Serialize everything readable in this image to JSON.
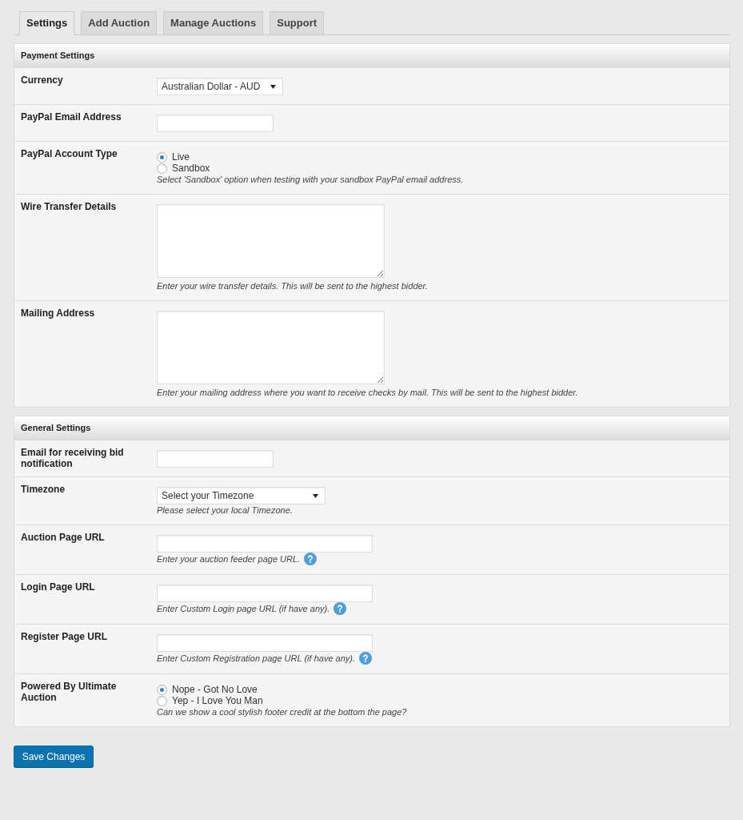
{
  "tabs": [
    {
      "label": "Settings",
      "selected": true
    },
    {
      "label": "Add Auction",
      "selected": false
    },
    {
      "label": "Manage Auctions",
      "selected": false
    },
    {
      "label": "Support",
      "selected": false
    }
  ],
  "sections": [
    {
      "title": "Payment Settings",
      "fields": [
        {
          "kind": "select",
          "label": "Currency",
          "value": "Australian Dollar - AUD"
        },
        {
          "kind": "text",
          "label": "PayPal Email Address"
        },
        {
          "kind": "radio",
          "label": "PayPal Account Type",
          "options": [
            {
              "label": "Live",
              "selected": true
            },
            {
              "label": "Sandbox",
              "selected": false
            }
          ],
          "help": "Select 'Sandbox' option when testing with your sandbox PayPal email address."
        },
        {
          "kind": "textarea",
          "label": "Wire Transfer Details",
          "help": "Enter your wire transfer details. This will be sent to the highest bidder."
        },
        {
          "kind": "textarea",
          "label": "Mailing Address",
          "help": "Enter your mailing address where you want to receive checks by mail. This will be sent to the highest bidder."
        }
      ]
    },
    {
      "title": "General Settings",
      "fields": [
        {
          "kind": "text",
          "label": "Email for receiving bid notification"
        },
        {
          "kind": "select",
          "label": "Timezone",
          "value": "Select your Timezone",
          "help": "Please select your local Timezone."
        },
        {
          "kind": "url",
          "label": "Auction Page URL",
          "help": "Enter your auction feeder page URL."
        },
        {
          "kind": "url",
          "label": "Login Page URL",
          "help": "Enter Custom Login page URL (if have any)."
        },
        {
          "kind": "url",
          "label": "Register Page URL",
          "help": "Enter Custom Registration page URL (if have any)."
        },
        {
          "kind": "radio",
          "label": "Powered By Ultimate Auction",
          "options": [
            {
              "label": "Nope - Got No Love",
              "selected": true
            },
            {
              "label": "Yep - I Love You Man",
              "selected": false
            }
          ],
          "help": "Can we show a cool stylish footer credit at the bottom the page?"
        }
      ]
    }
  ],
  "save_button": "Save Changes"
}
